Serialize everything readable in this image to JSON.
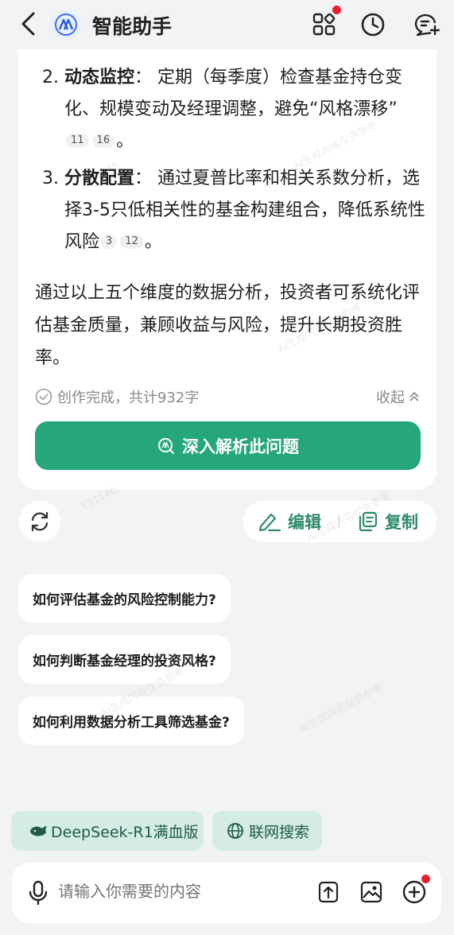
{
  "header": {
    "back_icon": "chevron-left-icon",
    "logo_icon": "assistant-logo-icon",
    "title": "智能助手",
    "icons": [
      "apps-grid-icon",
      "history-clock-icon",
      "new-chat-icon"
    ],
    "notify_color": "#e8202e"
  },
  "answer": {
    "items": [
      {
        "num": "2.",
        "title": "动态监控",
        "sep": "：",
        "text": "定期（每季度）检查基金持仓变化、规模变动及经理调整，避免“风格漂移”",
        "cites": [
          "11",
          "16"
        ],
        "end": "。"
      },
      {
        "num": "3.",
        "title": "分散配置",
        "sep": "：",
        "text": "通过夏普比率和相关系数分析，选择3-5只低相关性的基金构建组合，降低系统性风险",
        "cites": [
          "3",
          "12"
        ],
        "end": "。"
      }
    ],
    "summary": "通过以上五个维度的数据分析，投资者可系统化评估基金质量，兼顾收益与风险，提升长期投资胜率。",
    "status": "创作完成，共计932字",
    "collapse": "收起",
    "deep_button": "深入解析此问题"
  },
  "actions": {
    "edit": "编辑",
    "copy": "复制"
  },
  "suggestions": [
    "如何评估基金的风险控制能力?",
    "如何判断基金经理的投资风格?",
    "如何利用数据分析工具筛选基金?"
  ],
  "chips": {
    "model": "DeepSeek-R1满血版",
    "web_search": "联网搜索"
  },
  "input": {
    "placeholder": "请输入你需要的内容"
  },
  "watermark": {
    "line1": "Y3114б",
    "line2": "AI生成内容仅供参考"
  },
  "colors": {
    "accent": "#26a67c",
    "accent_text": "#2d8a6a",
    "chip_bg": "#d4ece3"
  }
}
